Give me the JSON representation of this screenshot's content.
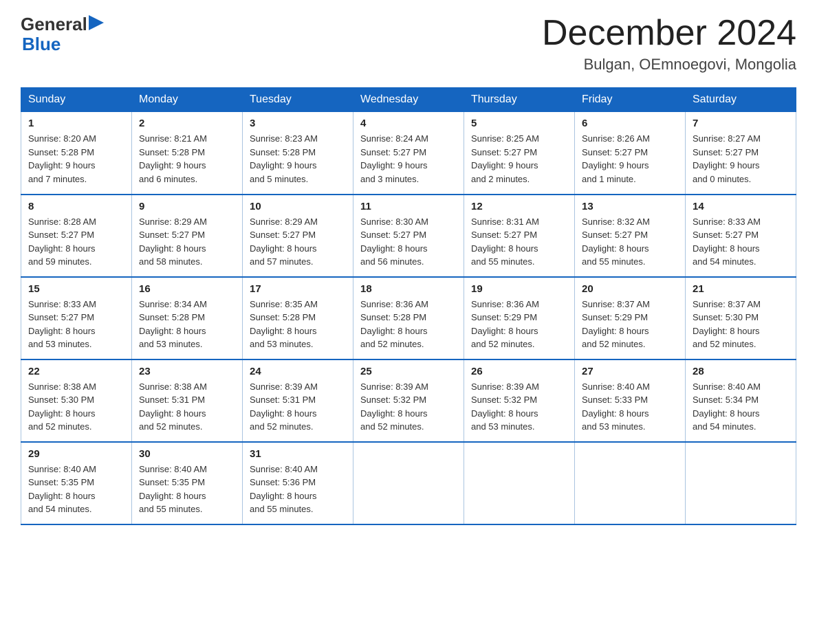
{
  "logo": {
    "general": "General",
    "arrow": "▶",
    "blue": "Blue"
  },
  "title": "December 2024",
  "location": "Bulgan, OEmnoegovi, Mongolia",
  "days_of_week": [
    "Sunday",
    "Monday",
    "Tuesday",
    "Wednesday",
    "Thursday",
    "Friday",
    "Saturday"
  ],
  "weeks": [
    [
      {
        "day": "1",
        "sunrise": "8:20 AM",
        "sunset": "5:28 PM",
        "daylight": "9 hours and 7 minutes."
      },
      {
        "day": "2",
        "sunrise": "8:21 AM",
        "sunset": "5:28 PM",
        "daylight": "9 hours and 6 minutes."
      },
      {
        "day": "3",
        "sunrise": "8:23 AM",
        "sunset": "5:28 PM",
        "daylight": "9 hours and 5 minutes."
      },
      {
        "day": "4",
        "sunrise": "8:24 AM",
        "sunset": "5:27 PM",
        "daylight": "9 hours and 3 minutes."
      },
      {
        "day": "5",
        "sunrise": "8:25 AM",
        "sunset": "5:27 PM",
        "daylight": "9 hours and 2 minutes."
      },
      {
        "day": "6",
        "sunrise": "8:26 AM",
        "sunset": "5:27 PM",
        "daylight": "9 hours and 1 minute."
      },
      {
        "day": "7",
        "sunrise": "8:27 AM",
        "sunset": "5:27 PM",
        "daylight": "9 hours and 0 minutes."
      }
    ],
    [
      {
        "day": "8",
        "sunrise": "8:28 AM",
        "sunset": "5:27 PM",
        "daylight": "8 hours and 59 minutes."
      },
      {
        "day": "9",
        "sunrise": "8:29 AM",
        "sunset": "5:27 PM",
        "daylight": "8 hours and 58 minutes."
      },
      {
        "day": "10",
        "sunrise": "8:29 AM",
        "sunset": "5:27 PM",
        "daylight": "8 hours and 57 minutes."
      },
      {
        "day": "11",
        "sunrise": "8:30 AM",
        "sunset": "5:27 PM",
        "daylight": "8 hours and 56 minutes."
      },
      {
        "day": "12",
        "sunrise": "8:31 AM",
        "sunset": "5:27 PM",
        "daylight": "8 hours and 55 minutes."
      },
      {
        "day": "13",
        "sunrise": "8:32 AM",
        "sunset": "5:27 PM",
        "daylight": "8 hours and 55 minutes."
      },
      {
        "day": "14",
        "sunrise": "8:33 AM",
        "sunset": "5:27 PM",
        "daylight": "8 hours and 54 minutes."
      }
    ],
    [
      {
        "day": "15",
        "sunrise": "8:33 AM",
        "sunset": "5:27 PM",
        "daylight": "8 hours and 53 minutes."
      },
      {
        "day": "16",
        "sunrise": "8:34 AM",
        "sunset": "5:28 PM",
        "daylight": "8 hours and 53 minutes."
      },
      {
        "day": "17",
        "sunrise": "8:35 AM",
        "sunset": "5:28 PM",
        "daylight": "8 hours and 53 minutes."
      },
      {
        "day": "18",
        "sunrise": "8:36 AM",
        "sunset": "5:28 PM",
        "daylight": "8 hours and 52 minutes."
      },
      {
        "day": "19",
        "sunrise": "8:36 AM",
        "sunset": "5:29 PM",
        "daylight": "8 hours and 52 minutes."
      },
      {
        "day": "20",
        "sunrise": "8:37 AM",
        "sunset": "5:29 PM",
        "daylight": "8 hours and 52 minutes."
      },
      {
        "day": "21",
        "sunrise": "8:37 AM",
        "sunset": "5:30 PM",
        "daylight": "8 hours and 52 minutes."
      }
    ],
    [
      {
        "day": "22",
        "sunrise": "8:38 AM",
        "sunset": "5:30 PM",
        "daylight": "8 hours and 52 minutes."
      },
      {
        "day": "23",
        "sunrise": "8:38 AM",
        "sunset": "5:31 PM",
        "daylight": "8 hours and 52 minutes."
      },
      {
        "day": "24",
        "sunrise": "8:39 AM",
        "sunset": "5:31 PM",
        "daylight": "8 hours and 52 minutes."
      },
      {
        "day": "25",
        "sunrise": "8:39 AM",
        "sunset": "5:32 PM",
        "daylight": "8 hours and 52 minutes."
      },
      {
        "day": "26",
        "sunrise": "8:39 AM",
        "sunset": "5:32 PM",
        "daylight": "8 hours and 53 minutes."
      },
      {
        "day": "27",
        "sunrise": "8:40 AM",
        "sunset": "5:33 PM",
        "daylight": "8 hours and 53 minutes."
      },
      {
        "day": "28",
        "sunrise": "8:40 AM",
        "sunset": "5:34 PM",
        "daylight": "8 hours and 54 minutes."
      }
    ],
    [
      {
        "day": "29",
        "sunrise": "8:40 AM",
        "sunset": "5:35 PM",
        "daylight": "8 hours and 54 minutes."
      },
      {
        "day": "30",
        "sunrise": "8:40 AM",
        "sunset": "5:35 PM",
        "daylight": "8 hours and 55 minutes."
      },
      {
        "day": "31",
        "sunrise": "8:40 AM",
        "sunset": "5:36 PM",
        "daylight": "8 hours and 55 minutes."
      },
      null,
      null,
      null,
      null
    ]
  ],
  "labels": {
    "sunrise": "Sunrise:",
    "sunset": "Sunset:",
    "daylight": "Daylight:"
  }
}
